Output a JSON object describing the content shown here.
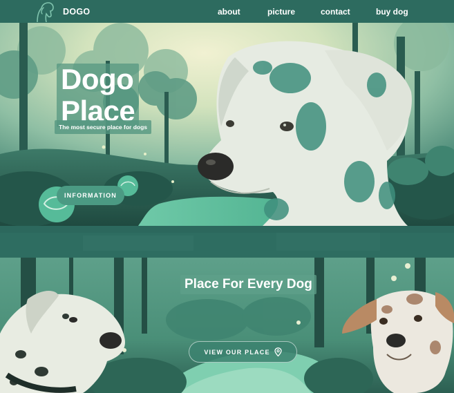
{
  "nav": {
    "brand": "DOGO",
    "links": [
      "about",
      "picture",
      "contact",
      "buy dog"
    ]
  },
  "hero": {
    "title_line1": "Dogo",
    "title_line2": "Place",
    "subtitle": "The most secure place for dogs",
    "button_label": "INFORMATION"
  },
  "section2": {
    "title": "Place For Every Dog",
    "button_label": "VIEW OUR PLACE",
    "button_icon": "location-pin-icon"
  },
  "colors": {
    "primary": "#2d6b5f",
    "accent": "#4b9a83",
    "light": "#dfe8c6",
    "text": "#ffffff"
  }
}
